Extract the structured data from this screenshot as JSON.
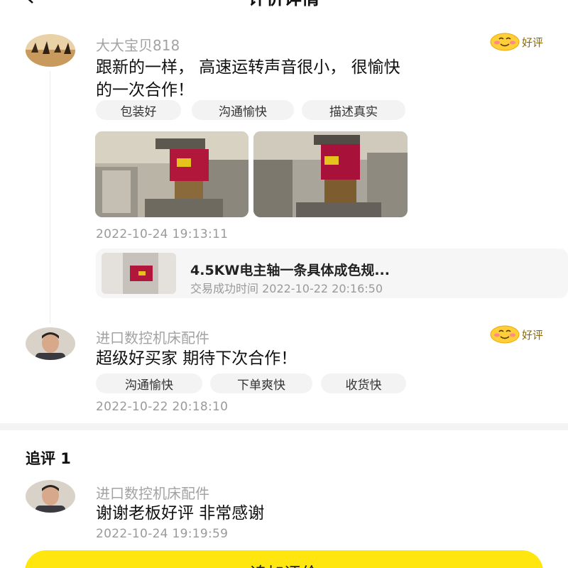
{
  "header": {
    "title": "评价详情"
  },
  "reviews": [
    {
      "username": "大大宝贝818",
      "badge": "好评",
      "text_line1": "跟新的一样， 高速运转声音很小， 很愉快",
      "text_line2": "的一次合作！",
      "tags": [
        "包装好",
        "沟通愉快",
        "描述真实"
      ],
      "timestamp": "2022-10-24 19:13:11"
    },
    {
      "username": "进口数控机床配件",
      "badge": "好评",
      "text": "超级好买家  期待下次合作！",
      "tags": [
        "沟通愉快",
        "下单爽快",
        "收货快"
      ],
      "timestamp": "2022-10-22 20:18:10"
    }
  ],
  "product": {
    "title": "4.5KW电主轴一条具体成色规...",
    "transaction": "交易成功时间 2022-10-22 20:16:50"
  },
  "followup": {
    "heading": "追评 1",
    "username": "进口数控机床配件",
    "text": "谢谢老板好评 非常感谢",
    "timestamp": "2022-10-24 19:19:59"
  },
  "action_button": {
    "label": "追加评价"
  },
  "colors": {
    "accent_yellow": "#ffe60f",
    "tag_bg": "#f3f3f3",
    "muted_text": "#9a9a9a"
  },
  "icons": {
    "back": "chevron-left-icon",
    "badge": "smiley-face-icon"
  }
}
